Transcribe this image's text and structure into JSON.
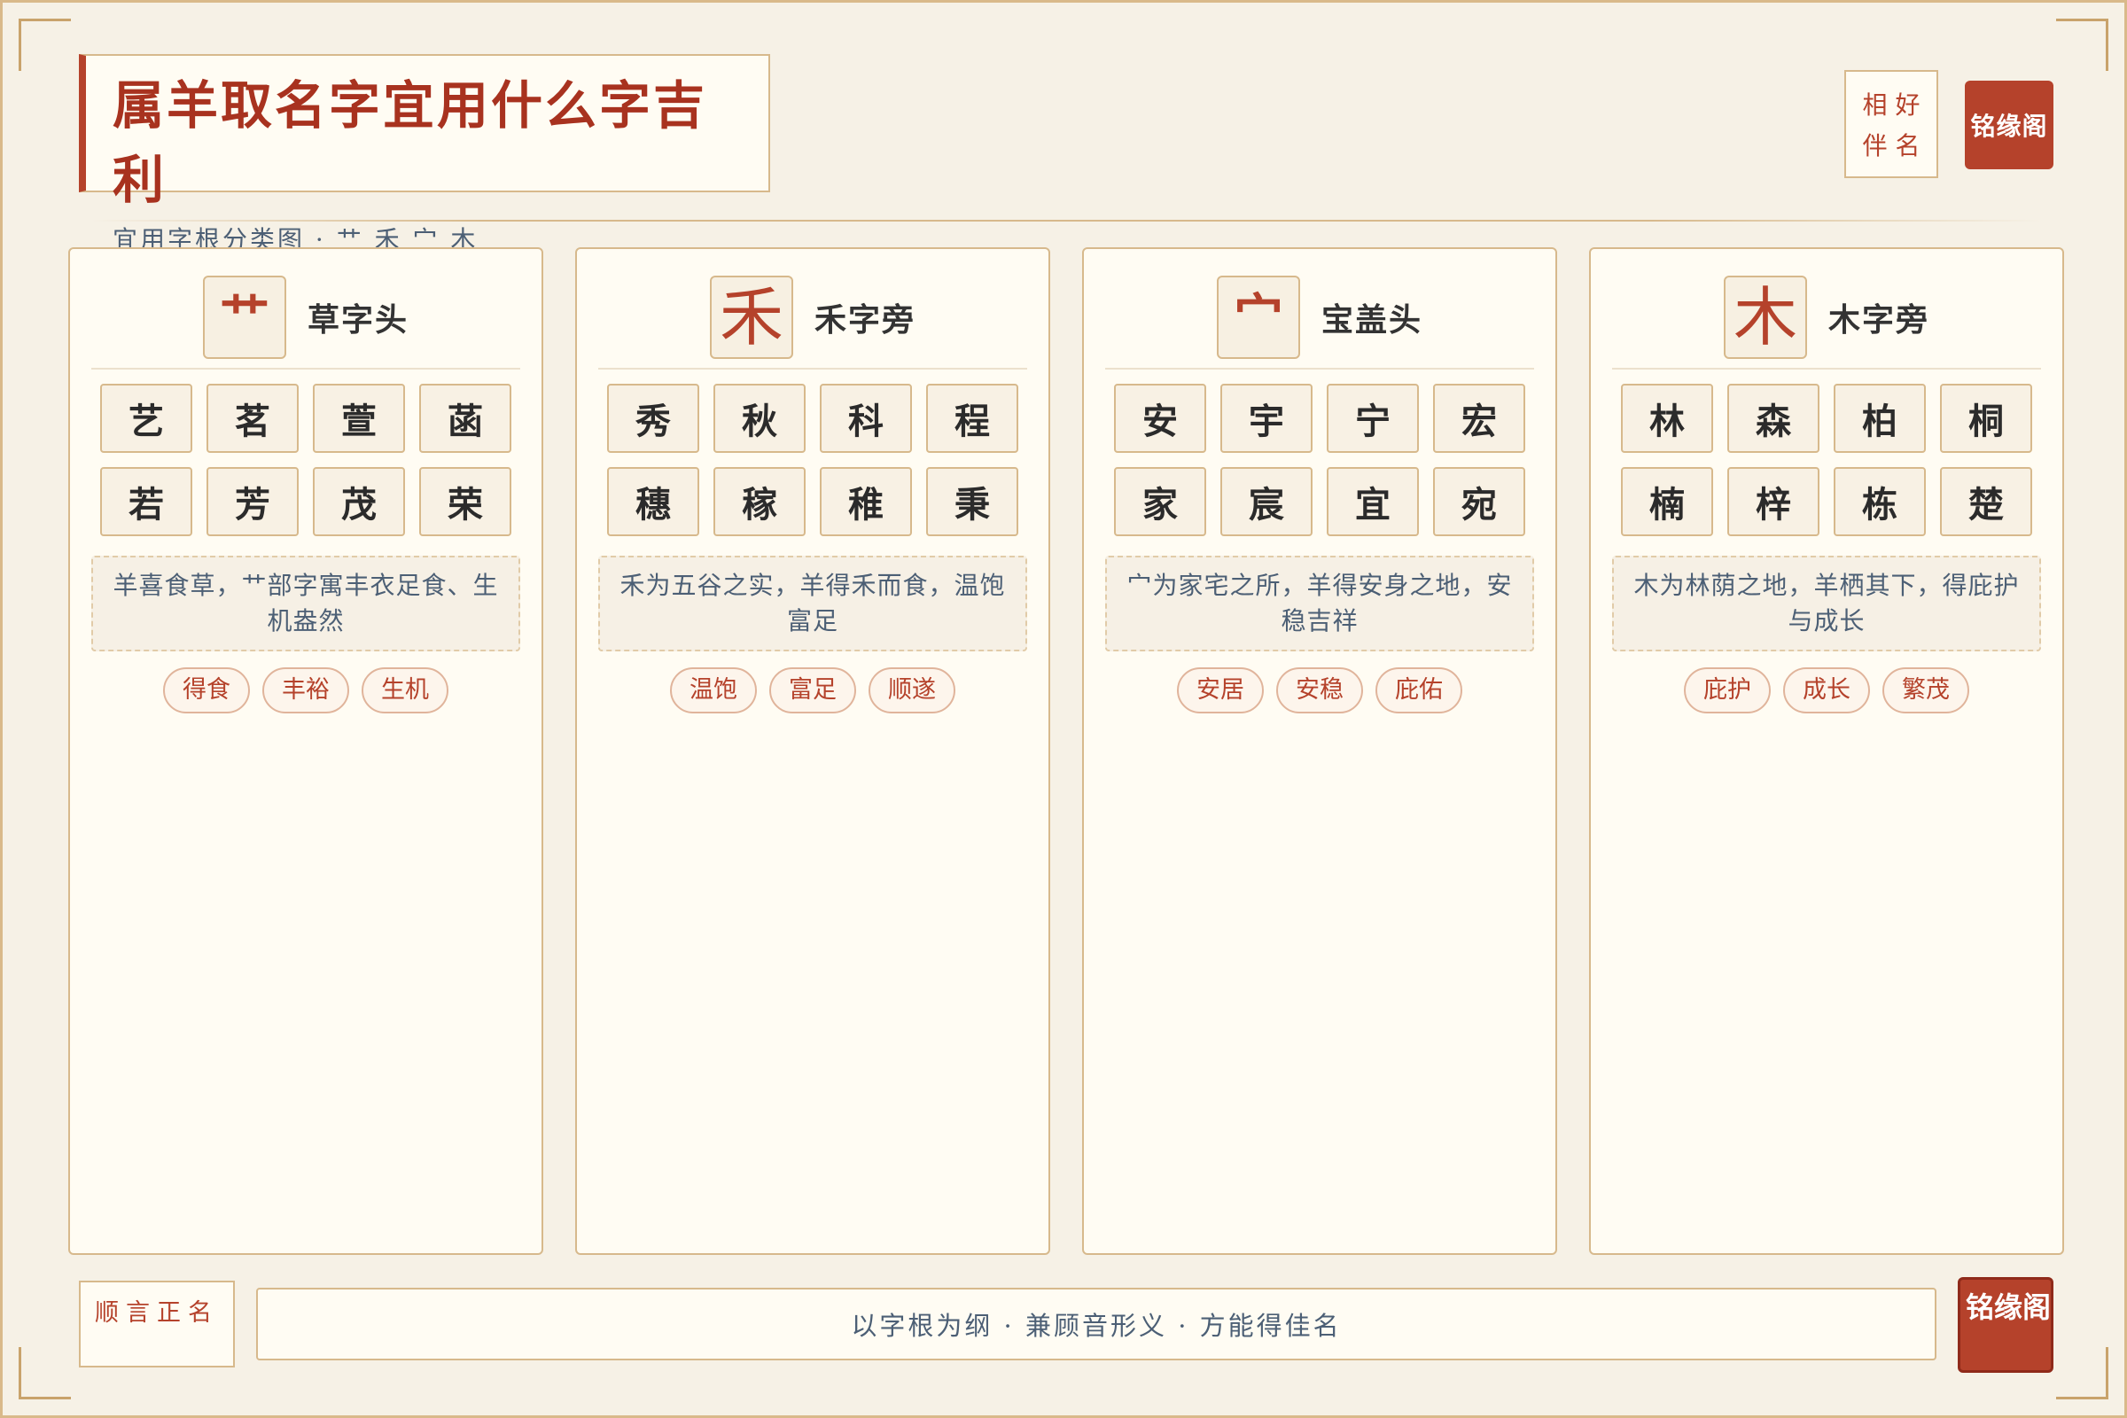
{
  "header": {
    "title": "属羊取名字宜用什么字吉利",
    "subtitle": "宜用字根分类图 · 艹 禾 宀 木",
    "seal_chars": [
      "相",
      "好",
      "伴",
      "名"
    ],
    "brand": "铭缘阁"
  },
  "columns": [
    {
      "radical": "艹",
      "name": "草字头",
      "chars": [
        "艺",
        "茗",
        "萱",
        "菡",
        "若",
        "芳",
        "茂",
        "荣"
      ],
      "note": "羊喜食草，艹部字寓丰衣足食、生机盎然",
      "tags": [
        "得食",
        "丰裕",
        "生机"
      ]
    },
    {
      "radical": "禾",
      "name": "禾字旁",
      "chars": [
        "秀",
        "秋",
        "科",
        "程",
        "穗",
        "稼",
        "稚",
        "秉"
      ],
      "note": "禾为五谷之实，羊得禾而食，温饱富足",
      "tags": [
        "温饱",
        "富足",
        "顺遂"
      ]
    },
    {
      "radical": "宀",
      "name": "宝盖头",
      "chars": [
        "安",
        "宇",
        "宁",
        "宏",
        "家",
        "宸",
        "宜",
        "宛"
      ],
      "note": "宀为家宅之所，羊得安身之地，安稳吉祥",
      "tags": [
        "安居",
        "安稳",
        "庇佑"
      ]
    },
    {
      "radical": "木",
      "name": "木字旁",
      "chars": [
        "林",
        "森",
        "柏",
        "桐",
        "楠",
        "梓",
        "栋",
        "楚"
      ],
      "note": "木为林荫之地，羊栖其下，得庇护与成长",
      "tags": [
        "庇护",
        "成长",
        "繁茂"
      ]
    }
  ],
  "footer": {
    "motto": "顺言正名",
    "slogan": "以字根为纲 · 兼顾音形义 · 方能得佳名",
    "brand": "铭缘阁"
  },
  "colors": {
    "accent": "#b5422b",
    "border": "#d7b98c",
    "paper": "#fffcf3",
    "background": "#f6f1e6",
    "text_blue": "#4c5f75"
  }
}
